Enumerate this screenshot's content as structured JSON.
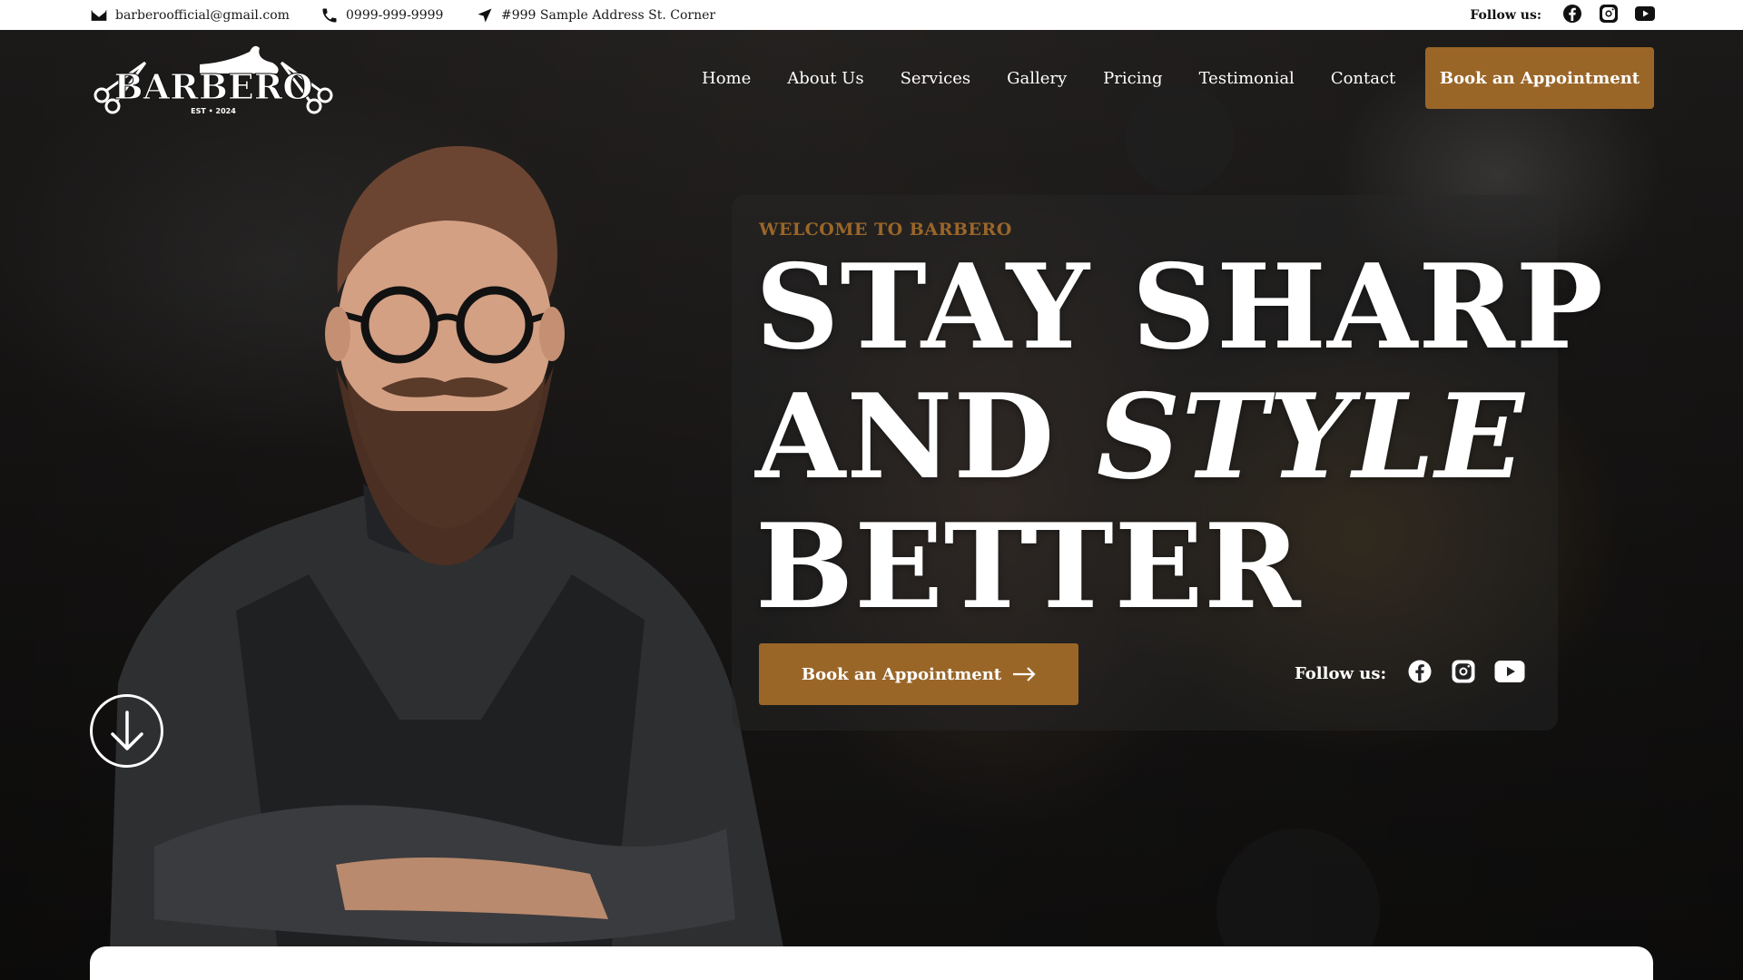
{
  "topbar": {
    "email": "barberoofficial@gmail.com",
    "phone": "0999-999-9999",
    "address": "#999 Sample Address St. Corner",
    "follow_label": "Follow us:",
    "icons": {
      "email": "envelope-icon",
      "phone": "phone-icon",
      "address": "location-arrow-icon",
      "social": [
        "facebook-icon",
        "instagram-icon",
        "youtube-icon"
      ]
    }
  },
  "nav": {
    "logo_text": "BARBERO",
    "logo_tagline": "EST • 2024",
    "links": [
      "Home",
      "About Us",
      "Services",
      "Gallery",
      "Pricing",
      "Testimonial",
      "Contact"
    ],
    "cta_label": "Book an Appointment"
  },
  "hero": {
    "eyebrow": "WELCOME TO BARBERO",
    "headline_line1": "STAY SHARP",
    "headline_line2a": "AND ",
    "headline_line2b": "STYLE",
    "headline_line3": "BETTER",
    "cta_label": "Book an Appointment",
    "follow_label": "Follow us:"
  },
  "colors": {
    "accent": "#9a6628",
    "topbar_bg": "#ffffff",
    "text_light": "#ffffff"
  }
}
